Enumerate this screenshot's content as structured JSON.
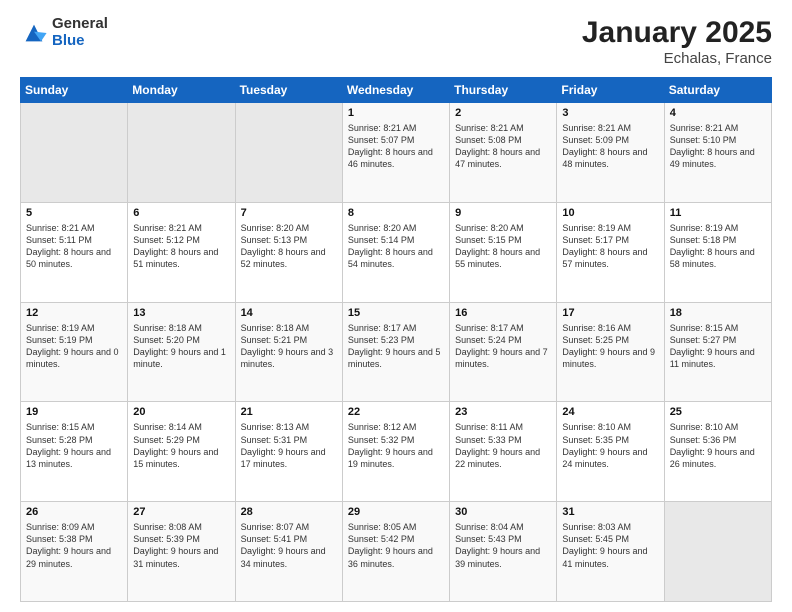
{
  "logo": {
    "general": "General",
    "blue": "Blue"
  },
  "title": "January 2025",
  "subtitle": "Echalas, France",
  "weekdays": [
    "Sunday",
    "Monday",
    "Tuesday",
    "Wednesday",
    "Thursday",
    "Friday",
    "Saturday"
  ],
  "weeks": [
    [
      {
        "day": "",
        "empty": true
      },
      {
        "day": "",
        "empty": true
      },
      {
        "day": "",
        "empty": true
      },
      {
        "day": "1",
        "sunrise": "8:21 AM",
        "sunset": "5:07 PM",
        "daylight": "8 hours and 46 minutes."
      },
      {
        "day": "2",
        "sunrise": "8:21 AM",
        "sunset": "5:08 PM",
        "daylight": "8 hours and 47 minutes."
      },
      {
        "day": "3",
        "sunrise": "8:21 AM",
        "sunset": "5:09 PM",
        "daylight": "8 hours and 48 minutes."
      },
      {
        "day": "4",
        "sunrise": "8:21 AM",
        "sunset": "5:10 PM",
        "daylight": "8 hours and 49 minutes."
      }
    ],
    [
      {
        "day": "5",
        "sunrise": "8:21 AM",
        "sunset": "5:11 PM",
        "daylight": "8 hours and 50 minutes."
      },
      {
        "day": "6",
        "sunrise": "8:21 AM",
        "sunset": "5:12 PM",
        "daylight": "8 hours and 51 minutes."
      },
      {
        "day": "7",
        "sunrise": "8:20 AM",
        "sunset": "5:13 PM",
        "daylight": "8 hours and 52 minutes."
      },
      {
        "day": "8",
        "sunrise": "8:20 AM",
        "sunset": "5:14 PM",
        "daylight": "8 hours and 54 minutes."
      },
      {
        "day": "9",
        "sunrise": "8:20 AM",
        "sunset": "5:15 PM",
        "daylight": "8 hours and 55 minutes."
      },
      {
        "day": "10",
        "sunrise": "8:19 AM",
        "sunset": "5:17 PM",
        "daylight": "8 hours and 57 minutes."
      },
      {
        "day": "11",
        "sunrise": "8:19 AM",
        "sunset": "5:18 PM",
        "daylight": "8 hours and 58 minutes."
      }
    ],
    [
      {
        "day": "12",
        "sunrise": "8:19 AM",
        "sunset": "5:19 PM",
        "daylight": "9 hours and 0 minutes."
      },
      {
        "day": "13",
        "sunrise": "8:18 AM",
        "sunset": "5:20 PM",
        "daylight": "9 hours and 1 minute."
      },
      {
        "day": "14",
        "sunrise": "8:18 AM",
        "sunset": "5:21 PM",
        "daylight": "9 hours and 3 minutes."
      },
      {
        "day": "15",
        "sunrise": "8:17 AM",
        "sunset": "5:23 PM",
        "daylight": "9 hours and 5 minutes."
      },
      {
        "day": "16",
        "sunrise": "8:17 AM",
        "sunset": "5:24 PM",
        "daylight": "9 hours and 7 minutes."
      },
      {
        "day": "17",
        "sunrise": "8:16 AM",
        "sunset": "5:25 PM",
        "daylight": "9 hours and 9 minutes."
      },
      {
        "day": "18",
        "sunrise": "8:15 AM",
        "sunset": "5:27 PM",
        "daylight": "9 hours and 11 minutes."
      }
    ],
    [
      {
        "day": "19",
        "sunrise": "8:15 AM",
        "sunset": "5:28 PM",
        "daylight": "9 hours and 13 minutes."
      },
      {
        "day": "20",
        "sunrise": "8:14 AM",
        "sunset": "5:29 PM",
        "daylight": "9 hours and 15 minutes."
      },
      {
        "day": "21",
        "sunrise": "8:13 AM",
        "sunset": "5:31 PM",
        "daylight": "9 hours and 17 minutes."
      },
      {
        "day": "22",
        "sunrise": "8:12 AM",
        "sunset": "5:32 PM",
        "daylight": "9 hours and 19 minutes."
      },
      {
        "day": "23",
        "sunrise": "8:11 AM",
        "sunset": "5:33 PM",
        "daylight": "9 hours and 22 minutes."
      },
      {
        "day": "24",
        "sunrise": "8:10 AM",
        "sunset": "5:35 PM",
        "daylight": "9 hours and 24 minutes."
      },
      {
        "day": "25",
        "sunrise": "8:10 AM",
        "sunset": "5:36 PM",
        "daylight": "9 hours and 26 minutes."
      }
    ],
    [
      {
        "day": "26",
        "sunrise": "8:09 AM",
        "sunset": "5:38 PM",
        "daylight": "9 hours and 29 minutes."
      },
      {
        "day": "27",
        "sunrise": "8:08 AM",
        "sunset": "5:39 PM",
        "daylight": "9 hours and 31 minutes."
      },
      {
        "day": "28",
        "sunrise": "8:07 AM",
        "sunset": "5:41 PM",
        "daylight": "9 hours and 34 minutes."
      },
      {
        "day": "29",
        "sunrise": "8:05 AM",
        "sunset": "5:42 PM",
        "daylight": "9 hours and 36 minutes."
      },
      {
        "day": "30",
        "sunrise": "8:04 AM",
        "sunset": "5:43 PM",
        "daylight": "9 hours and 39 minutes."
      },
      {
        "day": "31",
        "sunrise": "8:03 AM",
        "sunset": "5:45 PM",
        "daylight": "9 hours and 41 minutes."
      },
      {
        "day": "",
        "empty": true
      }
    ]
  ]
}
